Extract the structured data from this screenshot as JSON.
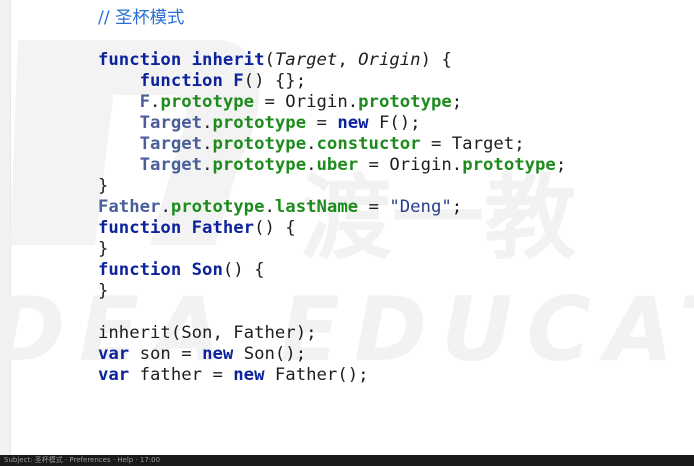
{
  "code": {
    "comment": "// 圣杯模式",
    "tokens": {
      "function": "function",
      "inherit": "inherit",
      "target": "Target",
      "origin": "Origin",
      "F": "F",
      "prototype": "prototype",
      "new": "new",
      "constuctor": "constuctor",
      "uber": "uber",
      "father": "Father",
      "lastName": "lastName",
      "deng": "\"Deng\"",
      "son": "Son",
      "var": "var",
      "son_var": "son",
      "father_var": "father"
    }
  },
  "watermark": {
    "brand_cn": "渡一教",
    "brand_en": "DEA EDUCATIO"
  },
  "status_bar": {
    "text": "Subject: 圣杯模式 · Preferences · Help · 17:00"
  }
}
